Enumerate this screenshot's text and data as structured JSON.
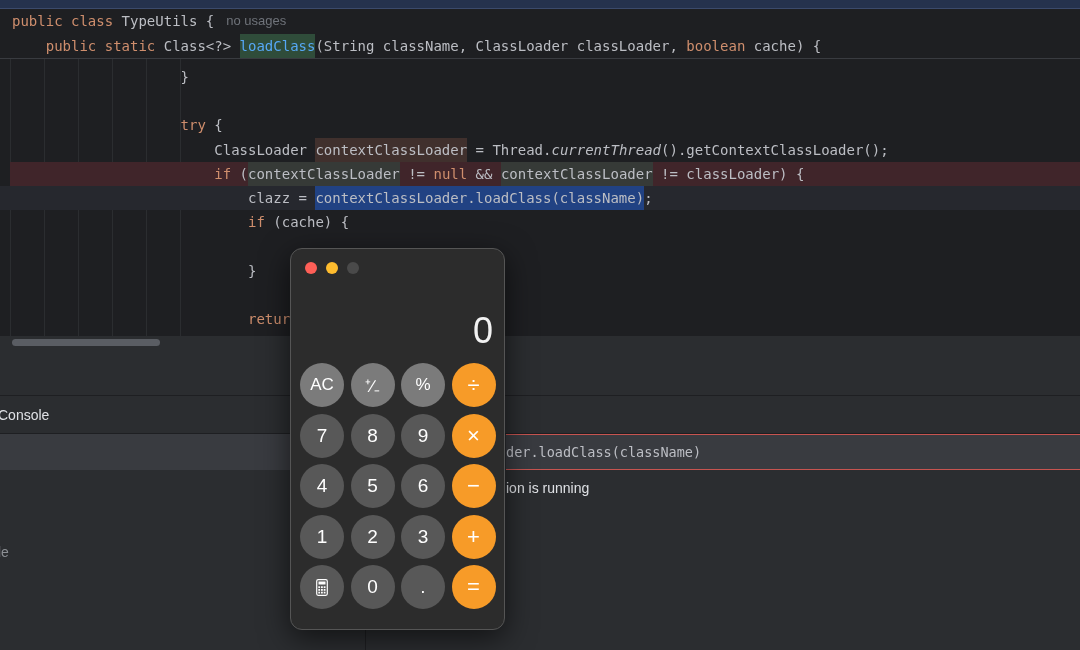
{
  "editor": {
    "sticky_lines": [
      {
        "segments": [
          {
            "text": "public class ",
            "kind": "keyword"
          },
          {
            "text": "TypeUtils {",
            "kind": "plain"
          },
          {
            "text": "no usages",
            "kind": "hint"
          }
        ]
      },
      {
        "segments": [
          {
            "text": "    public static ",
            "kind": "keyword"
          },
          {
            "text": "Class<?> ",
            "kind": "plain"
          },
          {
            "text": "loadClass",
            "kind": "method",
            "color": "#2f4c3a"
          },
          {
            "text": "(String className, ClassLoader classLoader, ",
            "kind": "plain"
          },
          {
            "text": "boolean ",
            "kind": "keyword"
          },
          {
            "text": "cache) {",
            "kind": "plain"
          }
        ]
      }
    ],
    "lines": [
      {
        "kind": "normal",
        "segments": [
          {
            "text": "                    }",
            "kind": "plain"
          }
        ]
      },
      {
        "kind": "normal"
      },
      {
        "kind": "normal",
        "segments": [
          {
            "text": "                    try ",
            "kind": "keyword"
          },
          {
            "text": "{",
            "kind": "plain"
          }
        ]
      },
      {
        "kind": "normal",
        "segments": [
          {
            "text": "                        ClassLoader ",
            "kind": "plain"
          },
          {
            "text": "contextClassLoader",
            "kind": "plain",
            "color": "#40302d"
          },
          {
            "text": " = Thread.",
            "kind": "plain"
          },
          {
            "text": "currentThread",
            "kind": "static"
          },
          {
            "text": "().getContextClassLoader();",
            "kind": "plain"
          }
        ]
      },
      {
        "kind": "breakpoint",
        "segments": [
          {
            "text": "                        if ",
            "kind": "keyword"
          },
          {
            "text": "(",
            "kind": "plain"
          },
          {
            "text": "contextClassLoader",
            "kind": "plain",
            "color": "#363a37"
          },
          {
            "text": " != ",
            "kind": "plain"
          },
          {
            "text": "null ",
            "kind": "keyword"
          },
          {
            "text": "&& ",
            "kind": "plain"
          },
          {
            "text": "contextClassLoader",
            "kind": "plain",
            "color": "#363a37"
          },
          {
            "text": " != classLoader) {",
            "kind": "plain"
          }
        ]
      },
      {
        "kind": "caret",
        "segments": [
          {
            "text": "                            clazz = ",
            "kind": "plain"
          },
          {
            "text": "contextClassLoader.loadClass(className)",
            "kind": "plain",
            "color": "#214283"
          },
          {
            "text": ";",
            "kind": "plain"
          }
        ]
      },
      {
        "kind": "normal",
        "segments": [
          {
            "text": "                            if ",
            "kind": "keyword"
          },
          {
            "text": "(cache) {",
            "kind": "plain"
          }
        ]
      },
      {
        "kind": "normal"
      },
      {
        "kind": "normal",
        "segments": [
          {
            "text": "                            }",
            "kind": "plain"
          }
        ]
      },
      {
        "kind": "normal"
      },
      {
        "kind": "normal",
        "segments": [
          {
            "text": "                            retur",
            "kind": "keyword"
          }
        ]
      }
    ]
  },
  "bottom_panel": {
    "tab": "Console",
    "expression": "der.loadClass(className)",
    "status": "ion is running",
    "side_label": "le"
  },
  "calculator": {
    "window_buttons": [
      {
        "color": "#fe5f57"
      },
      {
        "color": "#febc2e"
      },
      {
        "color": "#4a4a4a"
      }
    ],
    "display": "0",
    "keys": [
      {
        "kind": "function",
        "label": "AC"
      },
      {
        "kind": "function",
        "label": "⁺∕₋"
      },
      {
        "kind": "function",
        "label": "%"
      },
      {
        "kind": "operator",
        "label": "÷"
      },
      {
        "kind": "digit",
        "label": "7"
      },
      {
        "kind": "digit",
        "label": "8"
      },
      {
        "kind": "digit",
        "label": "9"
      },
      {
        "kind": "operator",
        "label": "×"
      },
      {
        "kind": "digit",
        "label": "4"
      },
      {
        "kind": "digit",
        "label": "5"
      },
      {
        "kind": "digit",
        "label": "6"
      },
      {
        "kind": "operator",
        "label": "−"
      },
      {
        "kind": "digit",
        "label": "1"
      },
      {
        "kind": "digit",
        "label": "2"
      },
      {
        "kind": "digit",
        "label": "3"
      },
      {
        "kind": "operator",
        "label": "+"
      },
      {
        "kind": "icon"
      },
      {
        "kind": "digit",
        "label": "0"
      },
      {
        "kind": "digit",
        "label": "."
      },
      {
        "kind": "operator",
        "label": "="
      }
    ]
  }
}
